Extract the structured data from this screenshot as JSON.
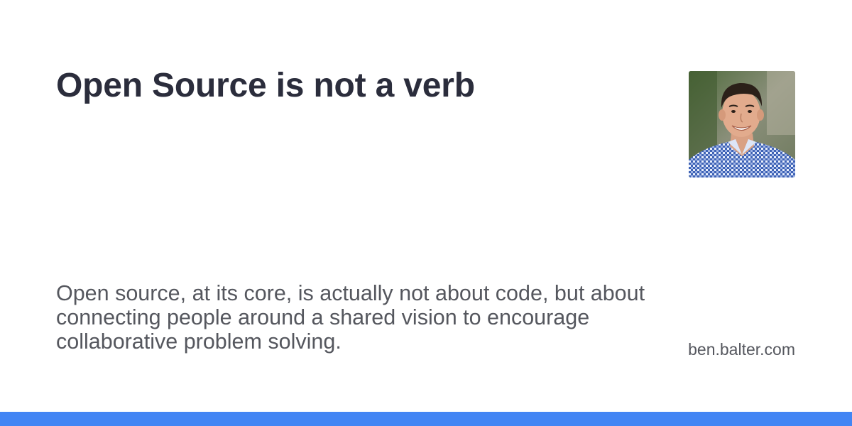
{
  "card": {
    "title": "Open Source is not a verb",
    "description": "Open source, at its core, is actually not about code, but about connecting people around a shared vision to encourage collaborative problem solving.",
    "domain": "ben.balter.com",
    "avatar_icon": "author-photo",
    "accent_color": "#4285f4",
    "title_color": "#2b2d3c",
    "text_color": "#55575e"
  }
}
